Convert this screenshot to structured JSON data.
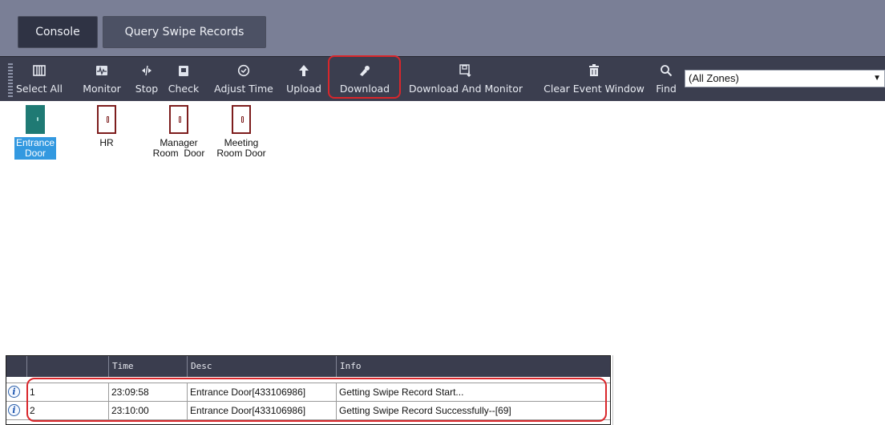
{
  "tabs": [
    {
      "label": "Console",
      "active": true
    },
    {
      "label": "Query Swipe Records",
      "active": false
    }
  ],
  "toolbar": {
    "buttons": [
      {
        "label": "Select All",
        "icon": "select-all-icon"
      },
      {
        "label": "Monitor",
        "icon": "monitor-icon"
      },
      {
        "label": "Stop",
        "icon": "stop-icon"
      },
      {
        "label": "Check",
        "icon": "check-icon"
      },
      {
        "label": "Adjust Time",
        "icon": "clock-icon"
      },
      {
        "label": "Upload",
        "icon": "upload-arrow-icon"
      },
      {
        "label": "Download",
        "icon": "download-icon",
        "highlighted": true
      },
      {
        "label": "Download And Monitor",
        "icon": "download-monitor-icon"
      },
      {
        "label": "Clear Event Window",
        "icon": "trash-icon"
      },
      {
        "label": "Find",
        "icon": "search-icon"
      }
    ],
    "zone_select": {
      "value": "(All Zones)"
    }
  },
  "doors": [
    {
      "name": "Entrance Door",
      "line1": "Entrance",
      "line2": "Door",
      "status": "open",
      "selected": true
    },
    {
      "name": "HR",
      "line1": "HR",
      "line2": "",
      "status": "closed",
      "selected": false
    },
    {
      "name": "Manager Room Door",
      "line1": "Manager",
      "line2": "Room  Door",
      "status": "closed",
      "selected": false
    },
    {
      "name": "Meeting Room Door",
      "line1": "Meeting",
      "line2": "Room Door",
      "status": "closed",
      "selected": false
    }
  ],
  "event_grid": {
    "columns": [
      "",
      "Time",
      "Desc",
      "Info"
    ],
    "rows": [
      {
        "index": "1",
        "time": "23:09:58",
        "desc": "Entrance Door[433106986]",
        "info": "Getting Swipe Record Start..."
      },
      {
        "index": "2",
        "time": "23:10:00",
        "desc": "Entrance Door[433106986]",
        "info": "Getting Swipe Record Successfully--[69]"
      }
    ]
  },
  "colors": {
    "tabbar_bg": "#7a7f96",
    "toolbar_bg": "#3b3e4f",
    "highlight": "#d9262b",
    "door_open": "#1f7a74",
    "door_closed_border": "#7d1d1d",
    "selection": "#3399e0"
  }
}
